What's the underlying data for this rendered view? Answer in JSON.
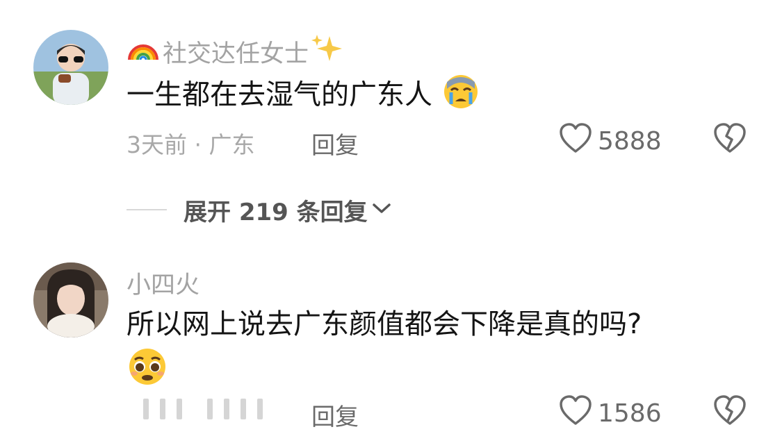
{
  "comments": [
    {
      "username": "社交达任女士",
      "text": "一生都在去湿气的广东人",
      "meta": "3天前 · 广东",
      "reply_label": "回复",
      "likes": "5888"
    },
    {
      "username": "小四火",
      "text": "所以网上说去广东颜值都会下降是真的吗?",
      "reply_label": "回复",
      "likes": "1586"
    }
  ],
  "expand": {
    "label": "展开 219 条回复"
  },
  "colors": {
    "username": "#a3a3a3",
    "text": "#141414",
    "meta": "#a8a8a8",
    "accent": "#6a6a6a"
  },
  "icons": [
    "rainbow-icon",
    "sparkles-icon",
    "crying-face-icon",
    "pleading-face-icon",
    "heart-icon",
    "broken-heart-icon",
    "chevron-down-icon"
  ]
}
